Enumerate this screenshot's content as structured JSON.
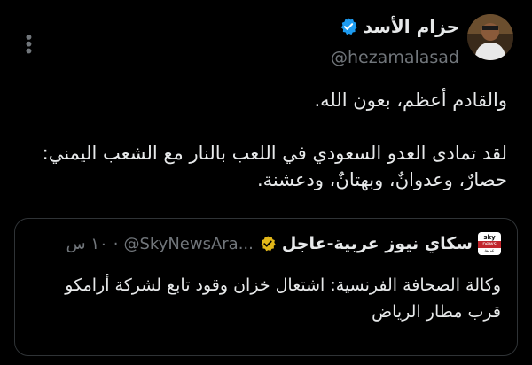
{
  "author": {
    "display_name": "حزام الأسد",
    "handle": "@hezamalasad",
    "verified_icon": "verified-badge-icon",
    "verified_color": "#1d9bf0"
  },
  "tweet": {
    "line1": "والقادم أعظم، بعون الله.",
    "line2": "لقد تمادى العدو السعودي في اللعب بالنار مع الشعب اليمني:",
    "line3": "حصارٌ، وعدوانٌ، وبهتانٌ، ودعشنة."
  },
  "quoted_tweet": {
    "logo_text_top": "sky",
    "logo_text_mid": "news",
    "logo_text_bottom": "عربية",
    "display_name": "سكاي نيوز عربية-عاجل",
    "verified_icon": "gold-verified-badge-icon",
    "verified_color": "#e2b719",
    "handle": "@SkyNewsAra...",
    "separator": "·",
    "time": "١٠ س",
    "text": "وكالة الصحافة الفرنسية: اشتعال خزان وقود تابع لشركة أرامكو قرب مطار الرياض"
  },
  "more_icon": "more-options-icon"
}
